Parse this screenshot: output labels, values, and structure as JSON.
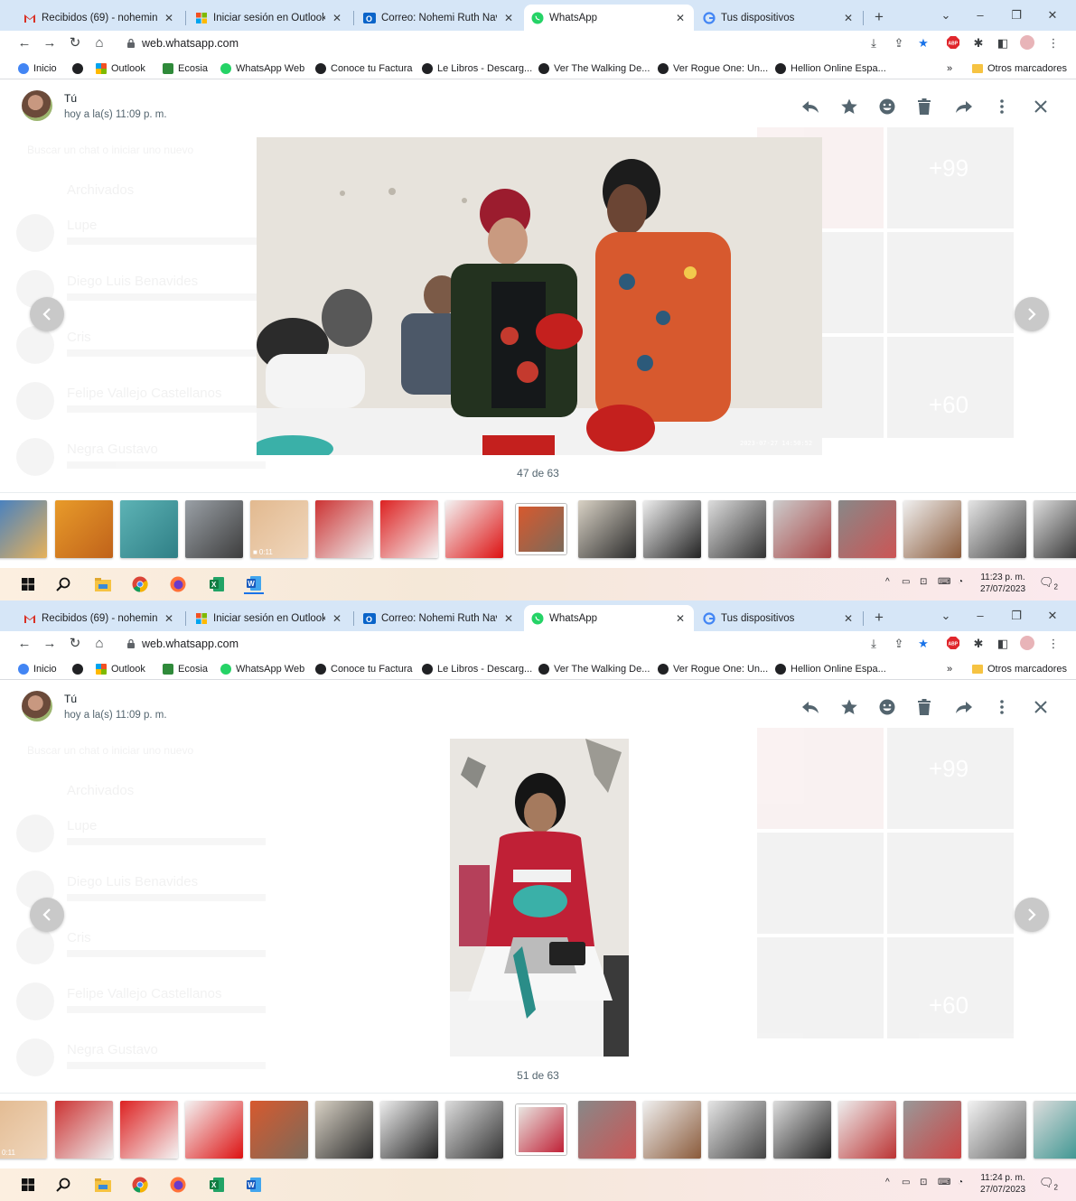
{
  "browser": {
    "tabs": [
      {
        "title": "Recibidos (69) - noheminaju",
        "icon": "gmail-icon",
        "color": "#d93025"
      },
      {
        "title": "Iniciar sesión en Outlook",
        "icon": "microsoft-icon",
        "color": "#f25022"
      },
      {
        "title": "Correo: Nohemi Ruth Navarr",
        "icon": "outlook-icon",
        "color": "#0a64c9"
      },
      {
        "title": "WhatsApp",
        "icon": "whatsapp-icon",
        "color": "#25d366",
        "active": true
      },
      {
        "title": "Tus dispositivos",
        "icon": "google-icon",
        "color": "#4285f4"
      }
    ],
    "url": "web.whatsapp.com",
    "bookmarks": [
      {
        "label": "Inicio",
        "icon": "inicio-icon",
        "color": "#4285f4"
      },
      {
        "label": "",
        "icon": "globe-icon",
        "color": "#202124"
      },
      {
        "label": "Outlook",
        "icon": "microsoft-icon",
        "color": "#f25022"
      },
      {
        "label": "Ecosia",
        "icon": "ecosia-icon",
        "color": "#2f8a3a"
      },
      {
        "label": "WhatsApp Web",
        "icon": "whatsapp-icon",
        "color": "#25d366"
      },
      {
        "label": "Conoce tu Factura",
        "icon": "globe-icon",
        "color": "#202124"
      },
      {
        "label": "Le Libros - Descarg...",
        "icon": "globe-icon",
        "color": "#202124"
      },
      {
        "label": "Ver The Walking De...",
        "icon": "globe-icon",
        "color": "#202124"
      },
      {
        "label": "Ver Rogue One: Un...",
        "icon": "globe-icon",
        "color": "#202124"
      },
      {
        "label": "Hellion Online Espa...",
        "icon": "globe-icon",
        "color": "#202124"
      }
    ],
    "bookmarks_more": "»",
    "other_bookmarks": "Otros marcadores"
  },
  "viewer": {
    "sender": "Tú",
    "time": "hoy a la(s) 11:09 p. m.",
    "actions": [
      "reply-icon",
      "star-icon",
      "emoji-icon",
      "delete-icon",
      "forward-icon",
      "menu-icon",
      "close-icon"
    ]
  },
  "ghost": {
    "search_placeholder": "Buscar un chat o iniciar uno nuevo",
    "archived": "Archivados",
    "chats": [
      "Lupe",
      "Diego Luis Benavides",
      "Cris",
      "Felipe Vallejo Castellanos",
      "Negra Gustavo"
    ],
    "grid_counts": [
      "+99",
      "+60"
    ]
  },
  "shots": [
    {
      "counter": "47 de 63",
      "photo_timestamp": "2023-07-27 14:50:52",
      "clock_time": "11:23 p. m.",
      "clock_date": "27/07/2023",
      "notif_count": "2",
      "video_duration": "0:11"
    },
    {
      "counter": "51 de 63",
      "photo_timestamp": "",
      "clock_time": "11:24 p. m.",
      "clock_date": "27/07/2023",
      "notif_count": "2",
      "video_duration": "0:11"
    }
  ],
  "taskbar": {
    "apps": [
      "windows-start-icon",
      "search-icon",
      "file-explorer-icon",
      "chrome-icon",
      "firefox-icon",
      "excel-icon",
      "word-icon"
    ],
    "tray": [
      "chevron-up-icon",
      "battery-icon",
      "network-icon",
      "keyboard-icon",
      "wifi-icon",
      "notification-icon"
    ]
  },
  "colors": {
    "tabstrip": "#d6e6f7",
    "whatsapp_green": "#25d366",
    "nav_circle": "#c9c9c9",
    "icon_gray": "#54656f"
  }
}
